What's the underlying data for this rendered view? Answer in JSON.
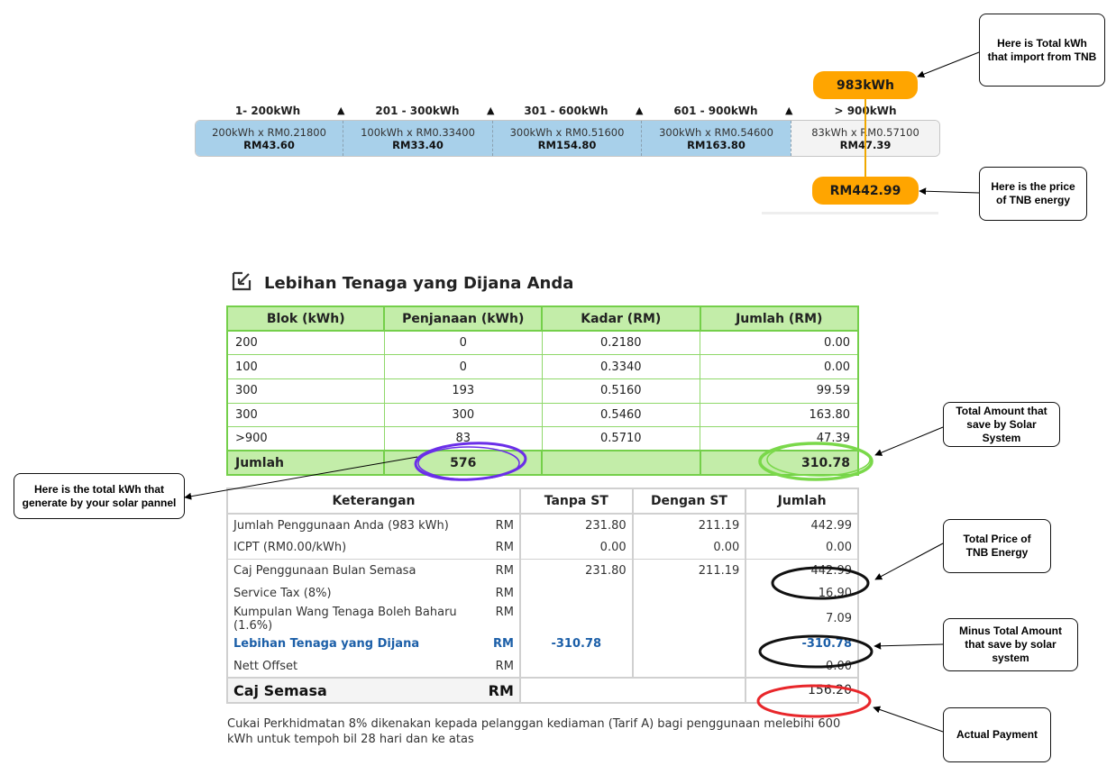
{
  "tiers": [
    {
      "header": "1- 200kWh",
      "calc": "200kWh x RM0.21800",
      "amount": "RM43.60"
    },
    {
      "header": "201 - 300kWh",
      "calc": "100kWh x RM0.33400",
      "amount": "RM33.40"
    },
    {
      "header": "301 - 600kWh",
      "calc": "300kWh x RM0.51600",
      "amount": "RM154.80"
    },
    {
      "header": "601 - 900kWh",
      "calc": "300kWh x RM0.54600",
      "amount": "RM163.80"
    },
    {
      "header": "> 900kWh",
      "calc": "83kWh x RM0.57100",
      "amount": "RM47.39"
    }
  ],
  "tier_arrow_glyph": "▲",
  "total_kwh_pill": "983kWh",
  "total_price_pill": "RM442.99",
  "callouts": {
    "import_kwh": "Here is Total kWh that import from TNB",
    "tnb_price": "Here is the price of TNB energy",
    "generated_kwh": "Here is the total kWh that generate by your solar pannel",
    "saved_amount": "Total Amount that save by Solar System",
    "total_price": "Total Price of TNB Energy",
    "minus_saved": "Minus Total Amount that save by solar system",
    "actual_payment": "Actual Payment"
  },
  "section_title": "Lebihan Tenaga yang Dijana Anda",
  "generation_table": {
    "headers": [
      "Blok (kWh)",
      "Penjanaan (kWh)",
      "Kadar (RM)",
      "Jumlah (RM)"
    ],
    "rows": [
      [
        "200",
        "0",
        "0.2180",
        "0.00"
      ],
      [
        "100",
        "0",
        "0.3340",
        "0.00"
      ],
      [
        "300",
        "193",
        "0.5160",
        "99.59"
      ],
      [
        "300",
        "300",
        "0.5460",
        "163.80"
      ],
      [
        ">900",
        "83",
        "0.5710",
        "47.39"
      ]
    ],
    "total": {
      "label": "Jumlah",
      "generation": "576",
      "amount": "310.78"
    }
  },
  "summary_table": {
    "headers": [
      "Keterangan",
      "Tanpa ST",
      "Dengan ST",
      "Jumlah"
    ],
    "currency": "RM",
    "rows": [
      {
        "label": "Jumlah Penggunaan Anda (983 kWh)",
        "tanpa": "231.80",
        "dengan": "211.19",
        "jumlah": "442.99"
      },
      {
        "label": "ICPT (RM0.00/kWh)",
        "tanpa": "0.00",
        "dengan": "0.00",
        "jumlah": "0.00"
      },
      {
        "label": "Caj Penggunaan Bulan Semasa",
        "tanpa": "231.80",
        "dengan": "211.19",
        "jumlah": "442.99"
      },
      {
        "label": "Service Tax (8%)",
        "tanpa": "",
        "dengan": "",
        "jumlah": "16.90"
      },
      {
        "label": "Kumpulan Wang Tenaga Boleh Baharu (1.6%)",
        "tanpa": "",
        "dengan": "",
        "jumlah": "7.09"
      },
      {
        "label": "Lebihan Tenaga yang Dijana",
        "tanpa": "-310.78",
        "dengan": "",
        "jumlah": "-310.78"
      },
      {
        "label": "Nett Offset",
        "tanpa": "",
        "dengan": "",
        "jumlah": "0.00"
      }
    ],
    "final": {
      "label": "Caj Semasa",
      "amount": "156.20"
    }
  },
  "footnote": "Cukai Perkhidmatan 8% dikenakan kepada pelanggan kediaman (Tarif A) bagi penggunaan melebihi 600 kWh untuk tempoh bil 28 hari dan ke atas",
  "colors": {
    "tier_blue": "#a8d0ea",
    "pill_orange": "#ffa500",
    "table_green": "#c3eda9",
    "highlight_purple": "#6a2ee8",
    "highlight_green": "#7ad84a",
    "highlight_red": "#e8262a",
    "value_blue": "#1c5fa8"
  }
}
